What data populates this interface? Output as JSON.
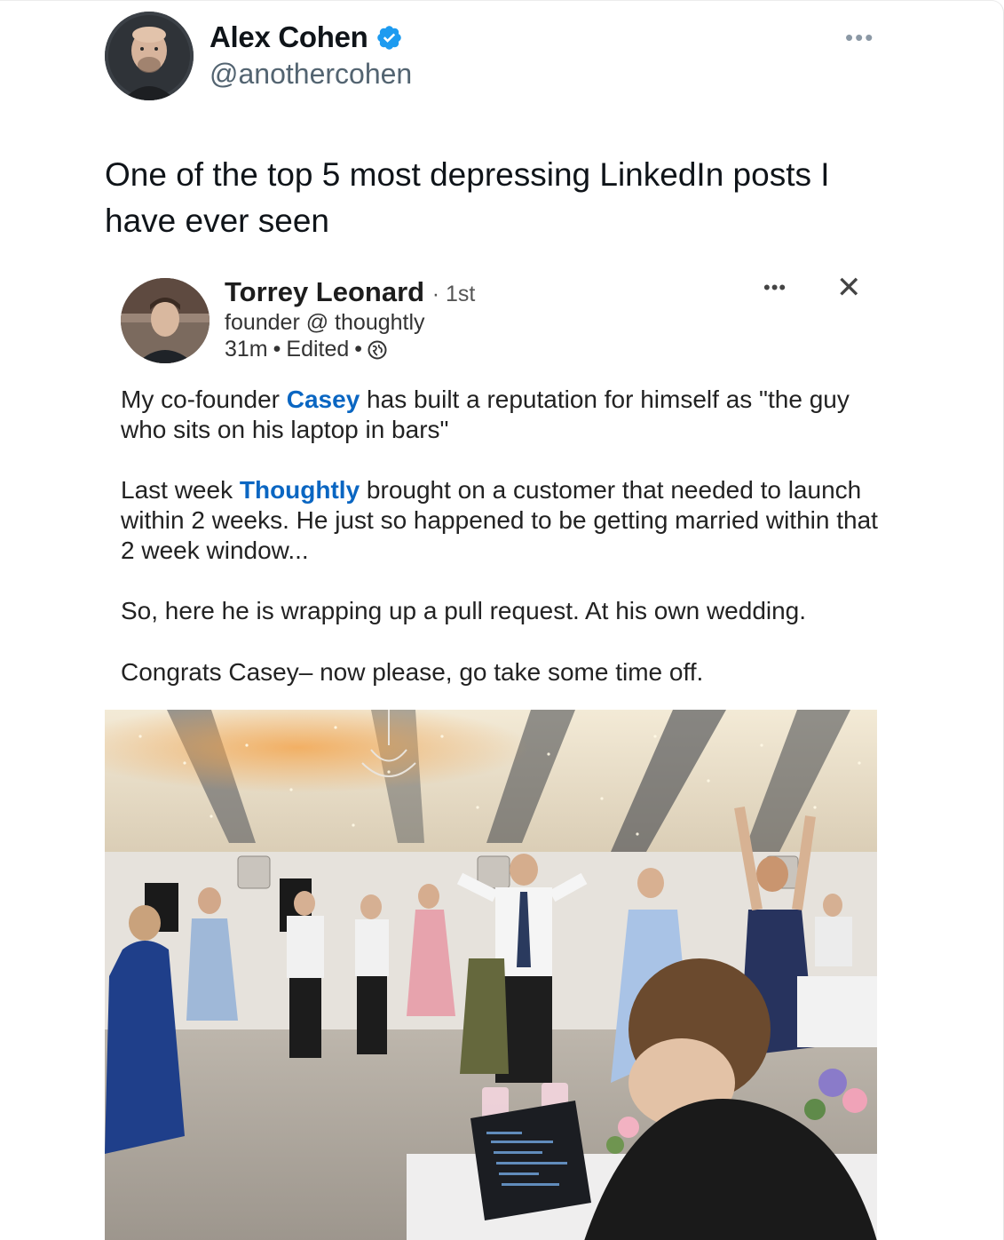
{
  "tweet": {
    "author_name": "Alex Cohen",
    "author_handle": "@anothercohen",
    "more_icon": "•••",
    "text": "One of the top 5 most depressing LinkedIn posts I have ever seen"
  },
  "linkedin_post": {
    "author_name": "Torrey Leonard",
    "degree": "· 1st",
    "headline": "founder @ thoughtly",
    "time": "31m",
    "edited": "Edited",
    "separator": "•",
    "more_icon": "•••",
    "close_icon": "✕",
    "paragraphs": {
      "p1_a": "My co-founder ",
      "p1_mention": "Casey",
      "p1_b": " has built a reputation for himself as \"the guy who sits on his laptop in bars\"",
      "p2_a": "Last week ",
      "p2_mention": "Thoughtly",
      "p2_b": " brought on a customer that needed to launch within 2 weeks. He just so happened to be getting married within that 2 week window...",
      "p3": "So, here he is wrapping up a pull request. At his own wedding.",
      "p4": "Congrats Casey– now please, go take some time off."
    }
  },
  "colors": {
    "verified": "#1d9bf0",
    "mention": "#0a66c2",
    "handle": "#536471"
  }
}
